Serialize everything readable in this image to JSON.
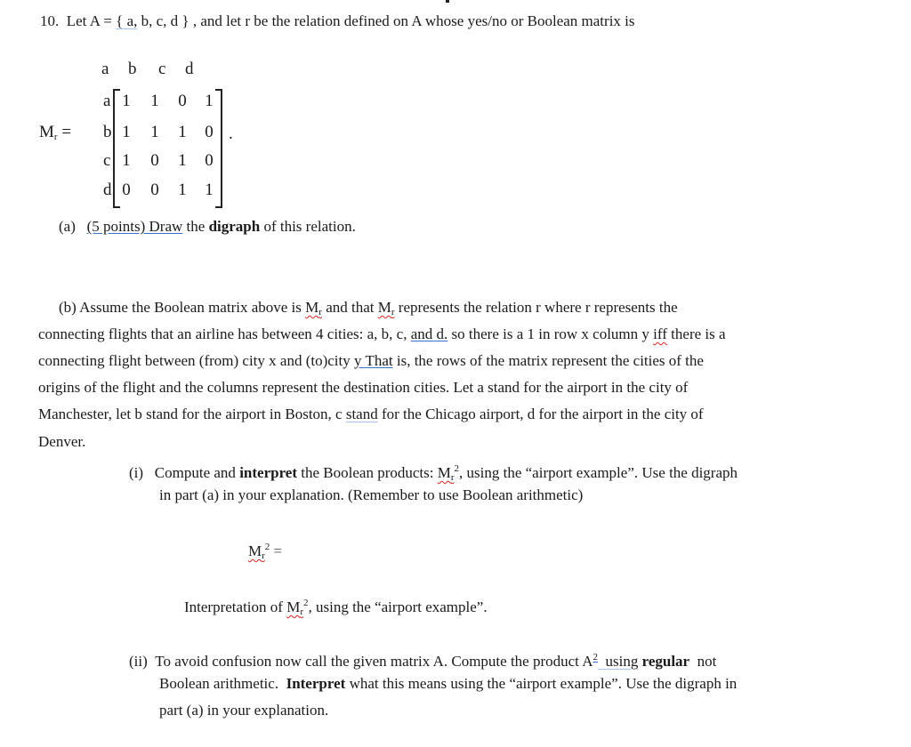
{
  "question": {
    "number": "10.",
    "intro_pre": "Let A = ",
    "set_open": "{",
    "set_first": " a,",
    "set_rest": " b, c, d }",
    "intro_post": " , and let r be the relation defined on A whose yes/no or Boolean matrix is"
  },
  "matrix": {
    "label": "M",
    "label_sub": "r",
    "equals": " =",
    "column_labels": [
      "a",
      "b",
      "c",
      "d"
    ],
    "row_labels": [
      "a",
      "b",
      "c",
      "d"
    ],
    "rows": [
      [
        "1",
        "1",
        "0",
        "1"
      ],
      [
        "1",
        "1",
        "1",
        "0"
      ],
      [
        "1",
        "0",
        "1",
        "0"
      ],
      [
        "0",
        "0",
        "1",
        "1"
      ]
    ],
    "trailing": "."
  },
  "part_a": {
    "label": "(a)",
    "points_underlined": "(5 points)  Draw",
    "text_1": " the ",
    "bold": "digraph",
    "text_2": " of this relation."
  },
  "part_b": {
    "line1_a": "(b)  Assume the Boolean matrix above is ",
    "mr": "M",
    "mr_sub": "r",
    "line1_b": " and that ",
    "line1_c": " represents the relation r where r represents the",
    "line2_a": "connecting flights that an airline has between 4 cities: a, b, c, ",
    "line2_ul": "and  d.",
    "line2_b": "  so there is a 1 in row x column y ",
    "line2_iff": "iff",
    "line2_c": " there is a",
    "line3_a": "connecting flight between (from) city x and (to)city ",
    "line3_ul": "y  That",
    "line3_b": " is, the rows of the matrix represent the cities of the",
    "line4": "origins of the flight and the columns represent the destination cities. Let a stand for the airport in the city of",
    "line5_a": "Manchester, let b stand for the airport in Boston, c ",
    "line5_ul": "stand",
    "line5_b": " for the Chicago airport, d for the airport in the city of",
    "line6": "Denver."
  },
  "part_i": {
    "label": "(i)",
    "line1_a": "Compute and ",
    "bold": "interpret",
    "line1_b": " the Boolean products: ",
    "mr": "M",
    "mr_sub": "r",
    "sup": "2",
    "line1_c": ", using the “airport example”.  Use the digraph",
    "line2": "in part (a) in your explanation.  (Remember to use Boolean arithmetic)",
    "answer_label_m": "M",
    "answer_label_sub": "r",
    "answer_label_sup": "2",
    "answer_equals": " =",
    "interp_a": "Interpretation of ",
    "interp_b": ", using the “airport example”."
  },
  "part_ii": {
    "label": "(ii)",
    "line1_a": "To avoid confusion now call the given matrix A. Compute the product ",
    "a_sq": "A",
    "a_sup": "2",
    "line1_ul": "  using",
    "line1_sp": " ",
    "bold1": "regular",
    "line1_b": "  not",
    "line2_a": "Boolean arithmetic.  ",
    "bold2": "Interpret",
    "line2_b": " what this means using the “airport example”. Use the digraph in",
    "line3": "part (a) in your explanation."
  }
}
